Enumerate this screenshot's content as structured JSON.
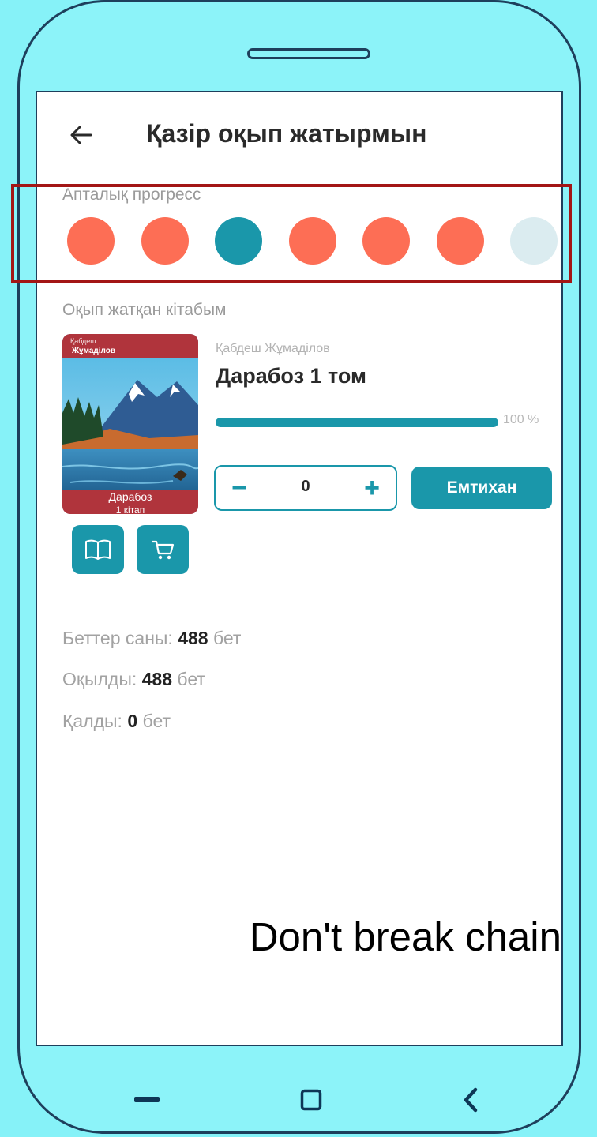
{
  "header": {
    "title": "Қазір оқып жатырмын"
  },
  "weekly_progress": {
    "label": "Апталық прогресс",
    "days": [
      {
        "state": "missed",
        "color": "#fd6e55"
      },
      {
        "state": "missed",
        "color": "#fd6e55"
      },
      {
        "state": "read",
        "color": "#1a97aa"
      },
      {
        "state": "missed",
        "color": "#fd6e55"
      },
      {
        "state": "missed",
        "color": "#fd6e55"
      },
      {
        "state": "missed",
        "color": "#fd6e55"
      },
      {
        "state": "upcoming",
        "color": "#dbecf0"
      }
    ]
  },
  "current_book": {
    "label": "Оқып жатқан кітабым",
    "author": "Қабдеш Жұмаділов",
    "title": "Дарабоз 1 том",
    "progress_fraction": 1.0,
    "progress_text": "100 %",
    "cover": {
      "author_small": "Қабдеш",
      "author_big": "Жұмаділов",
      "title": "Дарабоз",
      "subtitle": "1 кітап",
      "accent_color": "#b0343c"
    },
    "stepper": {
      "minus": "−",
      "value": "0",
      "plus": "+"
    },
    "exam_button": "Емтихан"
  },
  "stats": {
    "pages": {
      "label": "Беттер саны:",
      "value": "488",
      "unit": "бет"
    },
    "read": {
      "label": "Оқылды:",
      "value": "488",
      "unit": "бет"
    },
    "left": {
      "label": "Қалды:",
      "value": "0",
      "unit": "бет"
    }
  },
  "slogan": "Don't break chain",
  "colors": {
    "accent": "#1a97aa",
    "missed": "#fd6e55",
    "upcoming": "#dbecf0",
    "frame_background": "#86f2f8",
    "highlight": "#a31616"
  },
  "icons": {
    "back": "arrow-left-icon",
    "read": "open-book-icon",
    "buy": "shopping-cart-icon",
    "nav_recent": "recent-apps-icon",
    "nav_home": "home-square-icon",
    "nav_back": "chevron-left-icon"
  }
}
